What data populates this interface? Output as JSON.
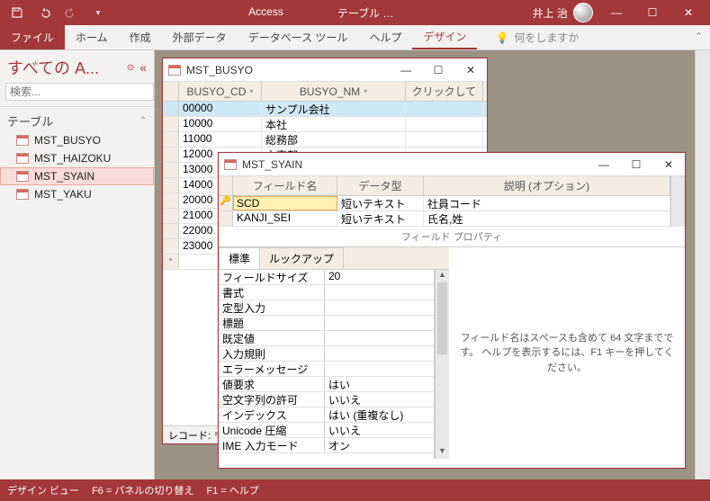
{
  "title_app": "Access",
  "title_context": "テーブル …",
  "user_name": "井上 治",
  "ribbon": {
    "file": "ファイル",
    "tabs": [
      "ホーム",
      "作成",
      "外部データ",
      "データベース ツール",
      "ヘルプ",
      "デザイン"
    ],
    "active_index": 5,
    "tell_me": "何をしますか"
  },
  "nav": {
    "title": "すべての A...",
    "search_placeholder": "検索...",
    "category": "テーブル",
    "items": [
      "MST_BUSYO",
      "MST_HAIZOKU",
      "MST_SYAIN",
      "MST_YAKU"
    ],
    "selected_index": 2
  },
  "busyo_window": {
    "title": "MST_BUSYO",
    "columns": [
      "BUSYO_CD",
      "BUSYO_NM",
      "クリックして"
    ],
    "rows": [
      [
        "00000",
        "サンプル会社"
      ],
      [
        "10000",
        "本社"
      ],
      [
        "11000",
        "総務部"
      ],
      [
        "12000",
        "人事部"
      ],
      [
        "13000",
        ""
      ],
      [
        "14000",
        ""
      ],
      [
        "20000",
        ""
      ],
      [
        "21000",
        ""
      ],
      [
        "22000",
        ""
      ],
      [
        "23000",
        ""
      ]
    ],
    "new_marker": "*",
    "rec_label": "レコード:"
  },
  "syain_window": {
    "title": "MST_SYAIN",
    "headers": {
      "field": "フィールド名",
      "type": "データ型",
      "desc": "説明 (オプション)"
    },
    "rows": [
      {
        "field": "SCD",
        "type": "短いテキスト",
        "desc": "社員コード",
        "key": true
      },
      {
        "field": "KANJI_SEI",
        "type": "短いテキスト",
        "desc": "氏名,姓",
        "key": false
      }
    ],
    "prop_header": "フィールド プロパティ",
    "tabs": {
      "general": "標準",
      "lookup": "ルックアップ"
    },
    "props": [
      [
        "フィールドサイズ",
        "20"
      ],
      [
        "書式",
        ""
      ],
      [
        "定型入力",
        ""
      ],
      [
        "標題",
        ""
      ],
      [
        "既定値",
        ""
      ],
      [
        "入力規則",
        ""
      ],
      [
        "エラーメッセージ",
        ""
      ],
      [
        "値要求",
        "はい"
      ],
      [
        "空文字列の許可",
        "いいえ"
      ],
      [
        "インデックス",
        "はい (重複なし)"
      ],
      [
        "Unicode 圧縮",
        "いいえ"
      ],
      [
        "IME 入力モード",
        "オン"
      ]
    ],
    "help": "フィールド名はスペースも含めて 64 文字までです。 ヘルプを表示するには、F1 キーを押してください。"
  },
  "status": {
    "view": "デザイン ビュー",
    "f6": "F6 = パネルの切り替え",
    "f1": "F1 = ヘルプ"
  }
}
